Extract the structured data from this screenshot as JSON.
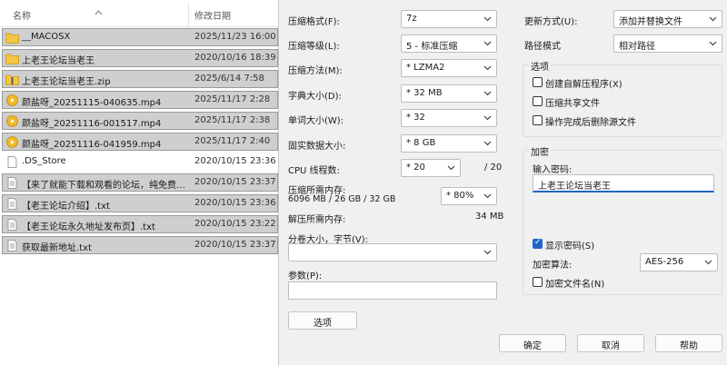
{
  "explorer": {
    "col_name": "名称",
    "col_date": "修改日期",
    "files": [
      {
        "name": "__MACOSX",
        "date": "2025/11/23 16:00",
        "icon": "folder-icon",
        "selected": true
      },
      {
        "name": "上老王论坛当老王",
        "date": "2020/10/16 18:39",
        "icon": "folder-icon",
        "selected": true
      },
      {
        "name": "上老王论坛当老王.zip",
        "date": "2025/6/14 7:58",
        "icon": "zip-folder-icon",
        "selected": true
      },
      {
        "name": "颜盐呀_20251115-040635.mp4",
        "date": "2025/11/17 2:28",
        "icon": "media-file-icon",
        "selected": true
      },
      {
        "name": "颜盐呀_20251116-001517.mp4",
        "date": "2025/11/17 2:38",
        "icon": "media-file-icon",
        "selected": true
      },
      {
        "name": "颜盐呀_20251116-041959.mp4",
        "date": "2025/11/17 2:40",
        "icon": "media-file-icon",
        "selected": true
      },
      {
        "name": ".DS_Store",
        "date": "2020/10/15 23:36",
        "icon": "file-icon",
        "selected": false
      },
      {
        "name": "【来了就能下载和观看的论坛，纯免费！...",
        "date": "2020/10/15 23:37",
        "icon": "text-file-icon",
        "selected": true
      },
      {
        "name": "【老王论坛介绍】.txt",
        "date": "2020/10/15 23:36",
        "icon": "text-file-icon",
        "selected": true
      },
      {
        "name": "【老王论坛永久地址发布页】.txt",
        "date": "2020/10/15 23:22",
        "icon": "text-file-icon",
        "selected": true
      },
      {
        "name": "获取最新地址.txt",
        "date": "2020/10/15 23:37",
        "icon": "text-file-icon",
        "selected": true
      }
    ]
  },
  "dialog": {
    "format_label": "压缩格式(F):",
    "format_value": "7z",
    "level_label": "压缩等级(L):",
    "level_value": "5 - 标准压缩",
    "method_label": "压缩方法(M):",
    "method_value": "* LZMA2",
    "dict_label": "字典大小(D):",
    "dict_value": "* 32 MB",
    "word_label": "单词大小(W):",
    "word_value": "* 32",
    "solid_label": "固实数据大小:",
    "solid_value": "* 8 GB",
    "threads_label": "CPU 线程数:",
    "threads_value": "* 20",
    "threads_total": "/ 20",
    "mem_comp_label": "压缩所需内存:",
    "mem_comp_detail": "6096 MB / 26 GB / 32 GB",
    "mem_comp_value": "* 80%",
    "mem_decomp_label": "解压所需内存:",
    "mem_decomp_value": "34 MB",
    "split_label": "分卷大小，字节(V):",
    "split_value": "",
    "params_label": "参数(P):",
    "params_value": "",
    "options_button": "选项",
    "update_label": "更新方式(U):",
    "update_value": "添加并替换文件",
    "path_label": "路径模式",
    "path_value": "相对路径",
    "options_group": "选项",
    "opt_sfx": "创建自解压程序(X)",
    "opt_sfx_checked": false,
    "opt_shared": "压缩共享文件",
    "opt_shared_checked": false,
    "opt_delete": "操作完成后删除源文件",
    "opt_delete_checked": false,
    "enc_group": "加密",
    "password_label": "输入密码:",
    "password_value": "上老王论坛当老王",
    "show_pw": "显示密码(S)",
    "show_pw_checked": true,
    "enc_method_label": "加密算法:",
    "enc_method_value": "AES-256",
    "encrypt_names": "加密文件名(N)",
    "encrypt_names_checked": false,
    "ok_button": "确定",
    "cancel_button": "取消",
    "help_button": "帮助"
  },
  "colors": {
    "selection": "#cfcfcf",
    "accent": "#1e66c8",
    "dialog_bg": "#f0f0f0"
  }
}
